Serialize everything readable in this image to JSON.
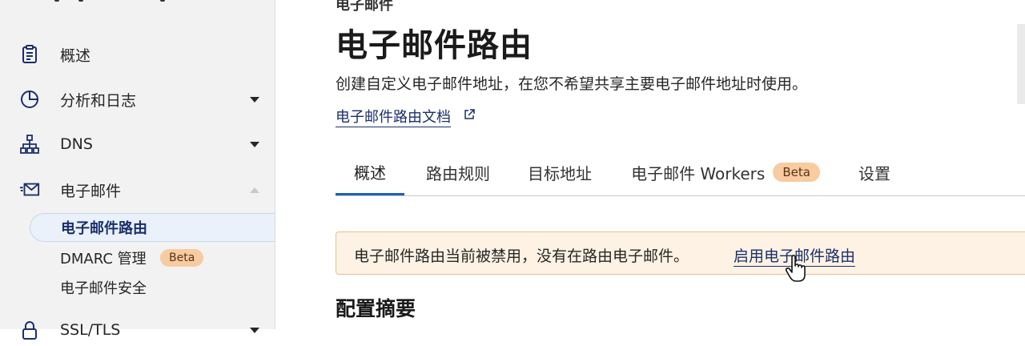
{
  "sidebar": {
    "items": [
      {
        "label": "概述",
        "icon": "clipboard-icon"
      },
      {
        "label": "分析和日志",
        "icon": "pie-chart-icon"
      },
      {
        "label": "DNS",
        "icon": "network-tree-icon"
      },
      {
        "label": "电子邮件",
        "icon": "email-icon"
      },
      {
        "label": "SSL/TLS",
        "icon": "lock-icon"
      }
    ],
    "email_sub": [
      {
        "label": "电子邮件路由"
      },
      {
        "label": "DMARC 管理",
        "badge": "Beta"
      },
      {
        "label": "电子邮件安全"
      }
    ]
  },
  "header": {
    "breadcrumb": "电子邮件",
    "title": "电子邮件路由",
    "description": "创建自定义电子邮件地址，在您不希望共享主要电子邮件地址时使用。",
    "doc_link": "电子邮件路由文档"
  },
  "tabs": [
    {
      "label": "概述"
    },
    {
      "label": "路由规则"
    },
    {
      "label": "目标地址"
    },
    {
      "label": "电子邮件 Workers",
      "badge": "Beta"
    },
    {
      "label": "设置"
    }
  ],
  "alert": {
    "text": "电子邮件路由当前被禁用，没有在路由电子邮件。",
    "link": "启用电子邮件路由"
  },
  "section_title": "配置摘要",
  "colors": {
    "accent": "#1b5fbe",
    "link": "#1a2f6b",
    "badge_bg": "#f8cba1",
    "alert_bg": "#fdf2e3"
  }
}
